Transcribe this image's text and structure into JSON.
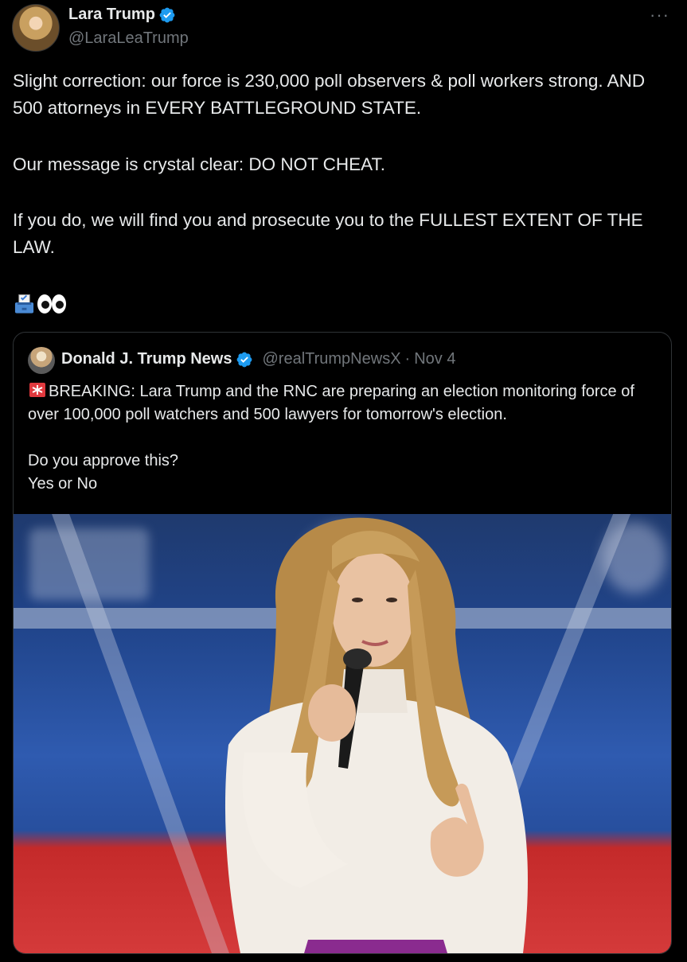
{
  "author": {
    "display_name": "Lara Trump",
    "handle": "@LaraLeaTrump",
    "verified": true
  },
  "more_menu": "···",
  "tweet": {
    "paragraph1": "Slight correction: our force is 230,000 poll observers & poll workers strong. AND 500 attorneys in EVERY BATTLEGROUND STATE.",
    "paragraph2": "Our message is crystal clear: DO NOT CHEAT.",
    "paragraph3": "If you do, we will find you and prosecute you to the FULLEST EXTENT OF THE LAW.",
    "emojis": [
      "ballot-box-icon",
      "eyes-icon"
    ]
  },
  "quoted": {
    "display_name": "Donald J. Trump News",
    "handle": "@realTrumpNewsX",
    "separator": "·",
    "date": "Nov 4",
    "verified": true,
    "line1": "BREAKING: Lara Trump and the RNC are preparing an election monitoring force of over 100,000 poll watchers and 500 lawyers for tomorrow's election.",
    "line2": "Do you approve this?",
    "line3": "Yes or No",
    "lead_icon": "siren-icon"
  },
  "colors": {
    "background": "#000000",
    "text": "#e7e9ea",
    "secondary": "#71767b",
    "verified": "#1d9bf0",
    "border": "#2f3336"
  }
}
